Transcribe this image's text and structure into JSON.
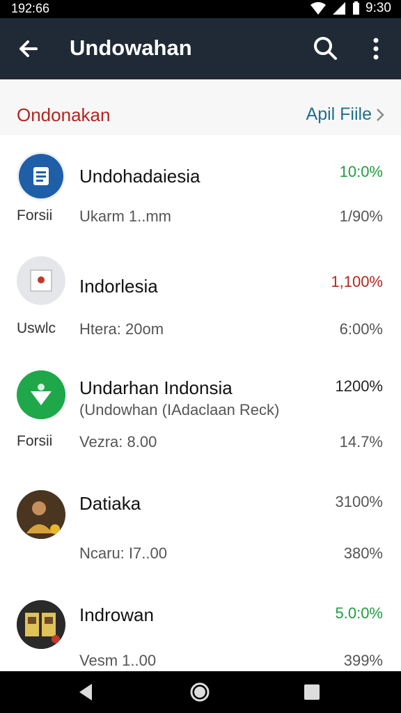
{
  "status_bar": {
    "time": "192:66",
    "clock": "9:30"
  },
  "app_bar": {
    "title": "Undowahan"
  },
  "section": {
    "name": "Ondonakan",
    "link": "Apil Fiile"
  },
  "rows": [
    {
      "title": "Undohadaiesia",
      "subtitle": "",
      "pct": "10:0%",
      "pct_color": "#1e9e3e",
      "left_label": "Forsii",
      "detail": "Ukarm 1..mm",
      "pct2": "1/90%"
    },
    {
      "title": "Indorlesia",
      "subtitle": "",
      "pct": "1,100%",
      "pct_color": "#b3261e",
      "left_label": "Uswlc",
      "detail": "Htera: 20om",
      "pct2": "6:00%"
    },
    {
      "title": "Undarhan Indonsia",
      "subtitle": "(Undowhan (IAdaclaan Reck)",
      "pct": "1200%",
      "pct_color": "#222222",
      "left_label": "Forsii",
      "detail": "Vezra: 8.00",
      "pct2": "14.7%"
    },
    {
      "title": "Datiaka",
      "subtitle": "",
      "pct": "3100%",
      "pct_color": "#555555",
      "left_label": "",
      "detail": "Ncaru: I7..00",
      "pct2": "380%"
    },
    {
      "title": "Indrowan",
      "subtitle": "",
      "pct": "5.0:0%",
      "pct_color": "#1e9e3e",
      "left_label": "",
      "detail": "Vesm 1..00",
      "pct2": "399%"
    }
  ]
}
